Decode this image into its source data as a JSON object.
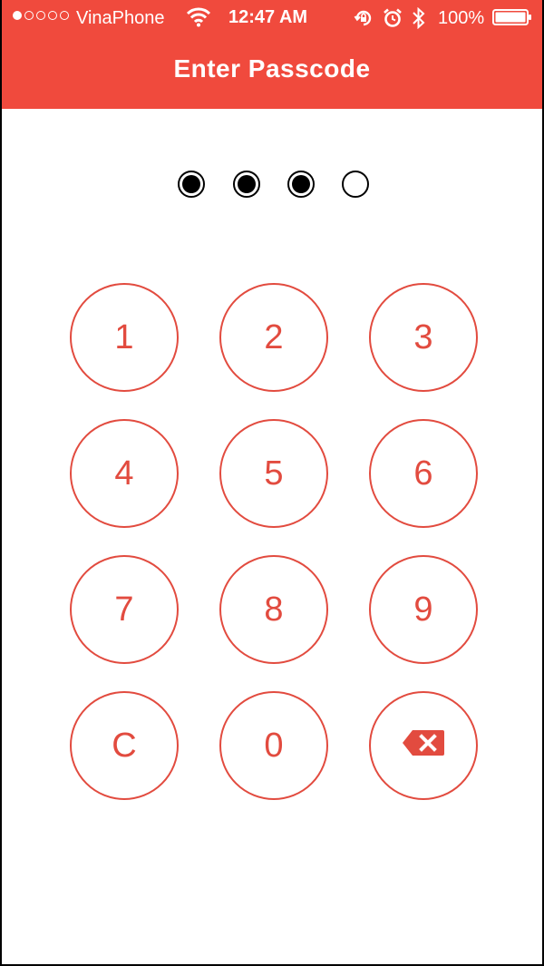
{
  "status_bar": {
    "carrier": "VinaPhone",
    "time": "12:47 AM",
    "battery": "100%",
    "signal_strength": 1,
    "signal_total": 5,
    "icons": [
      "wifi-icon",
      "rotation-lock-icon",
      "alarm-icon",
      "bluetooth-icon",
      "battery-icon"
    ]
  },
  "header": {
    "title": "Enter Passcode",
    "color": "#f04a3d"
  },
  "passcode": {
    "length": 4,
    "entered": 3
  },
  "keypad": {
    "accent_color": "#e24b3f",
    "keys": [
      {
        "label": "1"
      },
      {
        "label": "2"
      },
      {
        "label": "3"
      },
      {
        "label": "4"
      },
      {
        "label": "5"
      },
      {
        "label": "6"
      },
      {
        "label": "7"
      },
      {
        "label": "8"
      },
      {
        "label": "9"
      },
      {
        "label": "C"
      },
      {
        "label": "0"
      },
      {
        "label": "",
        "icon": "backspace-icon"
      }
    ]
  }
}
